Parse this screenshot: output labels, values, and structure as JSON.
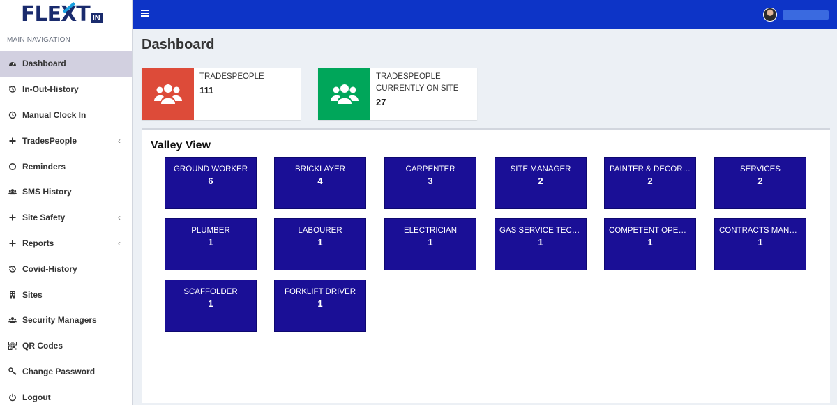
{
  "brand": {
    "logo_prefix": "FLE",
    "logo_x": "X",
    "logo_t": "T",
    "logo_badge": "IN"
  },
  "sidebar": {
    "header": "MAIN NAVIGATION",
    "items": [
      {
        "label": "Dashboard",
        "icon": "dashboard-icon",
        "active": true
      },
      {
        "label": "In-Out-History",
        "icon": "history-icon"
      },
      {
        "label": "Manual Clock In",
        "icon": "clock-icon"
      },
      {
        "label": "TradesPeople",
        "icon": "plus-icon",
        "expandable": true
      },
      {
        "label": "Reminders",
        "icon": "circle-icon"
      },
      {
        "label": "SMS History",
        "icon": "users-icon"
      },
      {
        "label": "Site Safety",
        "icon": "plus-icon",
        "expandable": true
      },
      {
        "label": "Reports",
        "icon": "plus-icon",
        "expandable": true
      },
      {
        "label": "Covid-History",
        "icon": "history-icon"
      },
      {
        "label": "Sites",
        "icon": "building-icon"
      },
      {
        "label": "Security Managers",
        "icon": "users-icon"
      },
      {
        "label": "QR Codes",
        "icon": "qrcode-icon"
      },
      {
        "label": "Change Password",
        "icon": "key-icon"
      },
      {
        "label": "Logout",
        "icon": "power-icon"
      }
    ]
  },
  "header": {
    "title": "Dashboard"
  },
  "stats": [
    {
      "label": "TRADESPEOPLE",
      "value": "111",
      "color": "#dd4b39"
    },
    {
      "label": "TRADESPEOPLE CURRENTLY ON SITE",
      "value": "27",
      "color": "#00a65a"
    }
  ],
  "site": {
    "name": "Valley View",
    "trades": [
      {
        "label": "GROUND WORKER",
        "count": "6"
      },
      {
        "label": "BRICKLAYER",
        "count": "4"
      },
      {
        "label": "CARPENTER",
        "count": "3"
      },
      {
        "label": "SITE MANAGER",
        "count": "2"
      },
      {
        "label": "PAINTER & DECOR…",
        "count": "2"
      },
      {
        "label": "SERVICES",
        "count": "2"
      },
      {
        "label": "PLUMBER",
        "count": "1"
      },
      {
        "label": "LABOURER",
        "count": "1"
      },
      {
        "label": "ELECTRICIAN",
        "count": "1"
      },
      {
        "label": "GAS SERVICE TECH…",
        "count": "1"
      },
      {
        "label": "COMPETENT OPER…",
        "count": "1"
      },
      {
        "label": "CONTRACTS MANA…",
        "count": "1"
      },
      {
        "label": "SCAFFOLDER",
        "count": "1"
      },
      {
        "label": "FORKLIFT DRIVER",
        "count": "1"
      }
    ]
  },
  "colors": {
    "topbar": "#0d34c7",
    "tile": "#1a0f96",
    "active_nav": "#d2d0e0"
  }
}
